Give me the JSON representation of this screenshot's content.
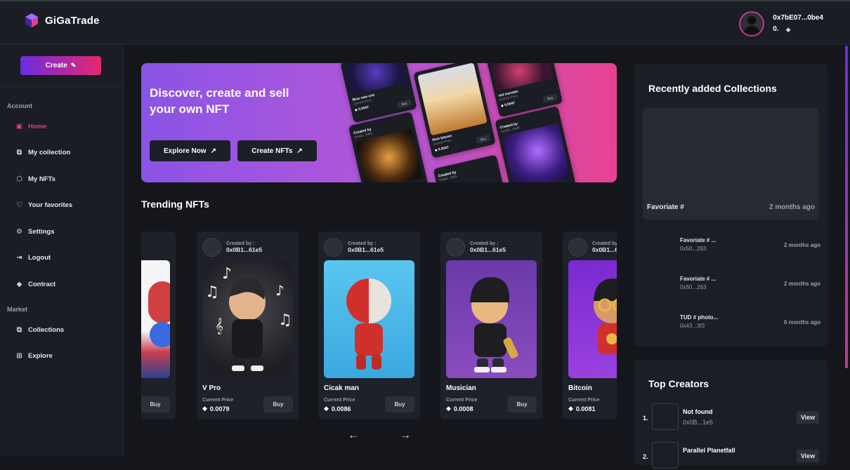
{
  "app": {
    "name": "GiGaTrade"
  },
  "user": {
    "address": "0x7bE07...0be4",
    "balance": "0."
  },
  "sidebar": {
    "create_label": "Create",
    "sections": [
      {
        "title": "Account"
      },
      {
        "title": "Market"
      }
    ],
    "items": [
      {
        "label": "Home",
        "icon": "home-icon"
      },
      {
        "label": "My collection",
        "icon": "collection-icon"
      },
      {
        "label": "My NFTs",
        "icon": "nft-icon"
      },
      {
        "label": "Your favorites",
        "icon": "heart-icon"
      },
      {
        "label": "Settings",
        "icon": "gear-icon"
      },
      {
        "label": "Logout",
        "icon": "logout-icon"
      },
      {
        "label": "Contract",
        "icon": "ethereum-icon"
      },
      {
        "label": "Collections",
        "icon": "collection-icon"
      },
      {
        "label": "Explore",
        "icon": "grid-icon"
      }
    ]
  },
  "hero": {
    "title": "Discover, create and sell your own NFT",
    "explore_label": "Explore Now",
    "create_label": "Create NFTs",
    "cards": [
      {
        "name": "Blue new cnit",
        "sub": "Current Price",
        "price": "0.0047",
        "buy": "Buy"
      },
      {
        "name": "Created by",
        "sub": "0x9a5...6465",
        "price": "",
        "buy": ""
      },
      {
        "name": "Rich bitcoin",
        "sub": "Current Price",
        "price": "0.0047",
        "buy": "Buy"
      },
      {
        "name": "Created by",
        "sub": "0x9a5...6465",
        "price": "",
        "buy": ""
      },
      {
        "name": "red monster",
        "sub": "Current Price",
        "price": "0.0047",
        "buy": "Buy"
      },
      {
        "name": "Created by",
        "sub": "0x1f5d...5a4E",
        "price": "",
        "buy": ""
      }
    ]
  },
  "trending": {
    "title": "Trending NFTs",
    "created_by_label": "Created by :",
    "price_label": "Current Price",
    "buy_label": "Buy",
    "items": [
      {
        "name": "",
        "creator": "",
        "price": ""
      },
      {
        "name": "V Pro",
        "creator": "0x0B1...61e5",
        "price": "0.0079"
      },
      {
        "name": "Cicak man",
        "creator": "0x0B1...61e5",
        "price": "0.0086"
      },
      {
        "name": "Musician",
        "creator": "0x0B1...61e5",
        "price": "0.0008"
      },
      {
        "name": "Bitcoin",
        "creator": "0x0B1...6",
        "price": "0.0081"
      }
    ]
  },
  "recent": {
    "title": "Recently added Collections",
    "featured": {
      "name": "Favoriate #",
      "time": "2 months ago"
    },
    "items": [
      {
        "name": "Favoriate # ...",
        "addr": "0x50...263",
        "time": "2 months ago"
      },
      {
        "name": "Favoriate # ...",
        "addr": "0x50...263",
        "time": "2 months ago"
      },
      {
        "name": "TUD # photo...",
        "addr": "0x43...3f3",
        "time": "6 months ago"
      }
    ]
  },
  "creators": {
    "title": "Top Creators",
    "view_label": "View",
    "items": [
      {
        "rank": "1.",
        "name": "Not found",
        "addr": "0x0B...1e5"
      },
      {
        "rank": "2.",
        "name": "Parallel Planetfall",
        "addr": ""
      }
    ]
  },
  "colors": {
    "accent_pink": "#e03a8a",
    "accent_purple": "#6a2ce0",
    "bg": "#14161c"
  }
}
